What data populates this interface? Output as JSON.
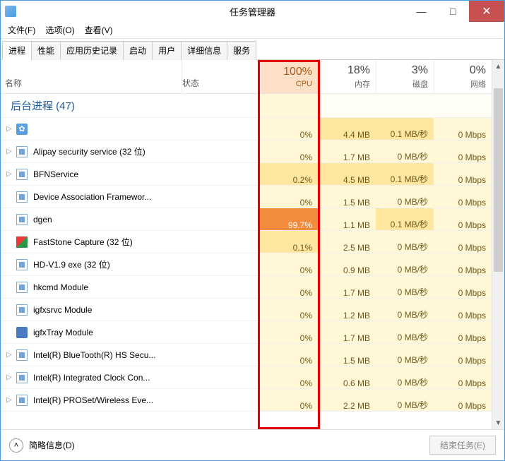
{
  "window": {
    "title": "任务管理器",
    "minimize": "—",
    "maximize": "□",
    "close": "✕"
  },
  "menu": [
    "文件(F)",
    "选项(O)",
    "查看(V)"
  ],
  "tabs": [
    "进程",
    "性能",
    "应用历史记录",
    "启动",
    "用户",
    "详细信息",
    "服务"
  ],
  "active_tab": 0,
  "columns": {
    "name": "名称",
    "status": "状态",
    "cpu": {
      "value": "100%",
      "label": "CPU"
    },
    "mem": {
      "value": "18%",
      "label": "内存"
    },
    "disk": {
      "value": "3%",
      "label": "磁盘"
    },
    "net": {
      "value": "0%",
      "label": "网络"
    }
  },
  "group_label": "后台进程 (47)",
  "processes": [
    {
      "expand": true,
      "icon": "gear",
      "name": "",
      "cpu": "0%",
      "cpu_heat": "low",
      "mem": "4.4 MB",
      "mem_heat": "med",
      "disk": "0.1 MB/秒",
      "disk_heat": "med",
      "net": "0 Mbps",
      "net_heat": "low"
    },
    {
      "expand": true,
      "icon": "default",
      "name": "Alipay security service (32 位)",
      "cpu": "0%",
      "cpu_heat": "low",
      "mem": "1.7 MB",
      "mem_heat": "low",
      "disk": "0 MB/秒",
      "disk_heat": "low",
      "net": "0 Mbps",
      "net_heat": "low"
    },
    {
      "expand": true,
      "icon": "default",
      "name": "BFNService",
      "cpu": "0.2%",
      "cpu_heat": "med",
      "mem": "4.5 MB",
      "mem_heat": "med",
      "disk": "0.1 MB/秒",
      "disk_heat": "med",
      "net": "0 Mbps",
      "net_heat": "low"
    },
    {
      "expand": false,
      "icon": "default",
      "name": "Device Association Framewor...",
      "cpu": "0%",
      "cpu_heat": "low",
      "mem": "1.5 MB",
      "mem_heat": "low",
      "disk": "0 MB/秒",
      "disk_heat": "low",
      "net": "0 Mbps",
      "net_heat": "low"
    },
    {
      "expand": false,
      "icon": "default",
      "name": "dgen",
      "cpu": "99.7%",
      "cpu_heat": "max",
      "mem": "1.1 MB",
      "mem_heat": "low",
      "disk": "0.1 MB/秒",
      "disk_heat": "med",
      "net": "0 Mbps",
      "net_heat": "low"
    },
    {
      "expand": false,
      "icon": "fs",
      "name": "FastStone Capture (32 位)",
      "cpu": "0.1%",
      "cpu_heat": "med",
      "mem": "2.5 MB",
      "mem_heat": "low",
      "disk": "0 MB/秒",
      "disk_heat": "low",
      "net": "0 Mbps",
      "net_heat": "low"
    },
    {
      "expand": false,
      "icon": "default",
      "name": "HD-V1.9 exe (32 位)",
      "cpu": "0%",
      "cpu_heat": "low",
      "mem": "0.9 MB",
      "mem_heat": "low",
      "disk": "0 MB/秒",
      "disk_heat": "low",
      "net": "0 Mbps",
      "net_heat": "low"
    },
    {
      "expand": false,
      "icon": "default",
      "name": "hkcmd Module",
      "cpu": "0%",
      "cpu_heat": "low",
      "mem": "1.7 MB",
      "mem_heat": "low",
      "disk": "0 MB/秒",
      "disk_heat": "low",
      "net": "0 Mbps",
      "net_heat": "low"
    },
    {
      "expand": false,
      "icon": "default",
      "name": "igfxsrvc Module",
      "cpu": "0%",
      "cpu_heat": "low",
      "mem": "1.2 MB",
      "mem_heat": "low",
      "disk": "0 MB/秒",
      "disk_heat": "low",
      "net": "0 Mbps",
      "net_heat": "low"
    },
    {
      "expand": false,
      "icon": "tray",
      "name": "igfxTray Module",
      "cpu": "0%",
      "cpu_heat": "low",
      "mem": "1.7 MB",
      "mem_heat": "low",
      "disk": "0 MB/秒",
      "disk_heat": "low",
      "net": "0 Mbps",
      "net_heat": "low"
    },
    {
      "expand": true,
      "icon": "default",
      "name": "Intel(R) BlueTooth(R) HS Secu...",
      "cpu": "0%",
      "cpu_heat": "low",
      "mem": "1.5 MB",
      "mem_heat": "low",
      "disk": "0 MB/秒",
      "disk_heat": "low",
      "net": "0 Mbps",
      "net_heat": "low"
    },
    {
      "expand": true,
      "icon": "default",
      "name": "Intel(R) Integrated Clock Con...",
      "cpu": "0%",
      "cpu_heat": "low",
      "mem": "0.6 MB",
      "mem_heat": "low",
      "disk": "0 MB/秒",
      "disk_heat": "low",
      "net": "0 Mbps",
      "net_heat": "low"
    },
    {
      "expand": true,
      "icon": "default",
      "name": "Intel(R) PROSet/Wireless Eve...",
      "cpu": "0%",
      "cpu_heat": "low",
      "mem": "2.2 MB",
      "mem_heat": "low",
      "disk": "0 MB/秒",
      "disk_heat": "low",
      "net": "0 Mbps",
      "net_heat": "low"
    }
  ],
  "footer": {
    "less": "简略信息(D)",
    "endtask": "结束任务(E)"
  }
}
